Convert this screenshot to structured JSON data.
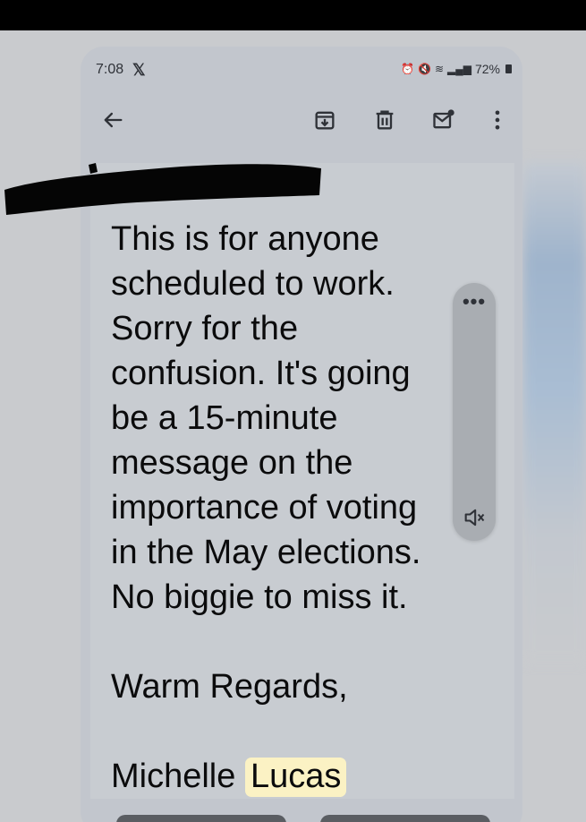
{
  "status_bar": {
    "time": "7:08",
    "app_icon": "x-logo-icon",
    "battery": "72%",
    "icons": [
      "alarm-icon",
      "mute-icon",
      "wifi-icon",
      "signal-icon",
      "battery-icon"
    ]
  },
  "toolbar": {
    "back_icon": "back-arrow-icon",
    "actions": [
      "archive-icon",
      "delete-icon",
      "mark-unread-icon",
      "more-options-icon"
    ]
  },
  "email": {
    "body_lines": [
      "This is for anyone",
      "scheduled to work.",
      "Sorry for the",
      "confusion. It's going",
      "be a 15-minute",
      "message on the",
      "importance of voting",
      "in the May elections.",
      "No biggie to miss it."
    ],
    "closing": "Warm Regards,",
    "signature_first": "Michelle",
    "signature_last": "Lucas"
  },
  "side_panel": {
    "menu_icon": "more-horizontal-icon",
    "volume_icon": "volume-muted-icon"
  },
  "colors": {
    "background": "#c9cbce",
    "text": "#0b0b0c",
    "highlight": "#fbf2c4"
  }
}
